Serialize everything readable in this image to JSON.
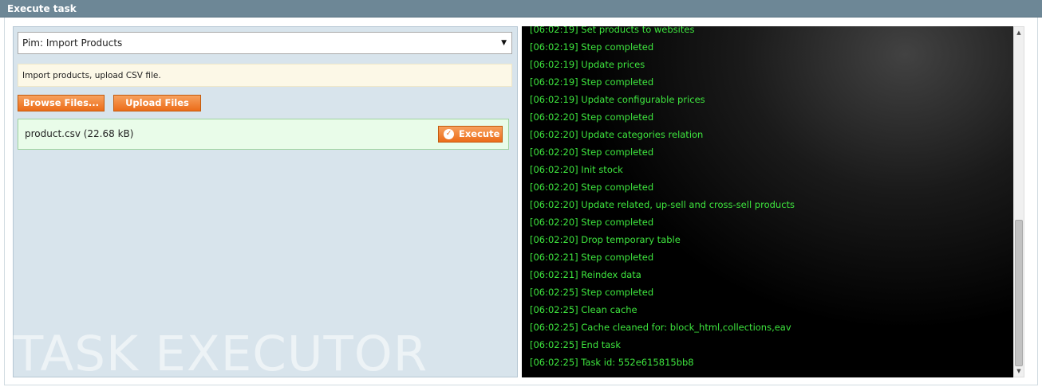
{
  "header": {
    "title": "Execute task"
  },
  "task_select": {
    "value": "Pim: Import Products"
  },
  "description": "Import products, upload CSV file.",
  "buttons": {
    "browse": "Browse Files...",
    "upload": "Upload Files",
    "execute": "Execute"
  },
  "file": {
    "name": "product.csv (22.68 kB)"
  },
  "watermark": "TASK EXECUTOR",
  "console": {
    "lines": [
      "[06:02:19] Set products to websites",
      "[06:02:19] Step completed",
      "[06:02:19] Update prices",
      "[06:02:19] Step completed",
      "[06:02:19] Update configurable prices",
      "[06:02:20] Step completed",
      "[06:02:20] Update categories relation",
      "[06:02:20] Step completed",
      "[06:02:20] Init stock",
      "[06:02:20] Step completed",
      "[06:02:20] Update related, up-sell and cross-sell products",
      "[06:02:20] Step completed",
      "[06:02:20] Drop temporary table",
      "[06:02:21] Step completed",
      "[06:02:21] Reindex data",
      "[06:02:25] Step completed",
      "[06:02:25] Clean cache",
      "[06:02:25] Cache cleaned for: block_html,collections,eav",
      "[06:02:25] End task",
      "[06:02:25] Task id: 552e615815bb8"
    ]
  },
  "colors": {
    "header": "#6d8796",
    "accent": "#ec6c19",
    "console_text": "#3ee63e"
  }
}
